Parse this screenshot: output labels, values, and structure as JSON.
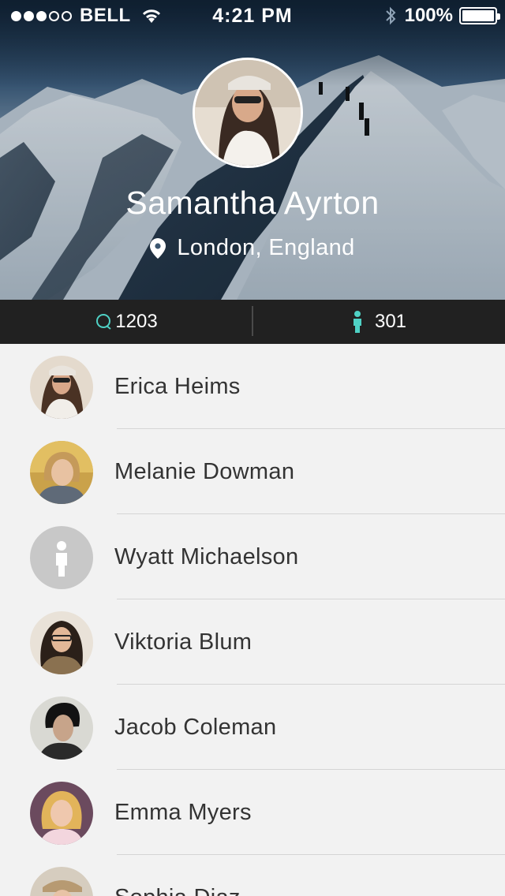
{
  "status_bar": {
    "carrier": "BELL",
    "time": "4:21 PM",
    "battery": "100%"
  },
  "profile": {
    "name": "Samantha Ayrton",
    "location": "London, England"
  },
  "stats": {
    "comments": "1203",
    "followers": "301"
  },
  "friends": [
    {
      "name": "Erica Heims",
      "avatar": "photo"
    },
    {
      "name": "Melanie Dowman",
      "avatar": "photo"
    },
    {
      "name": "Wyatt Michaelson",
      "avatar": "placeholder-person-icon"
    },
    {
      "name": "Viktoria Blum",
      "avatar": "photo"
    },
    {
      "name": "Jacob Coleman",
      "avatar": "photo"
    },
    {
      "name": "Emma Myers",
      "avatar": "photo"
    },
    {
      "name": "Sophia Diaz",
      "avatar": "photo"
    }
  ],
  "colors": {
    "accent": "#4fd1c5",
    "stats_bar": "#212121",
    "list_bg": "#f2f2f2"
  }
}
